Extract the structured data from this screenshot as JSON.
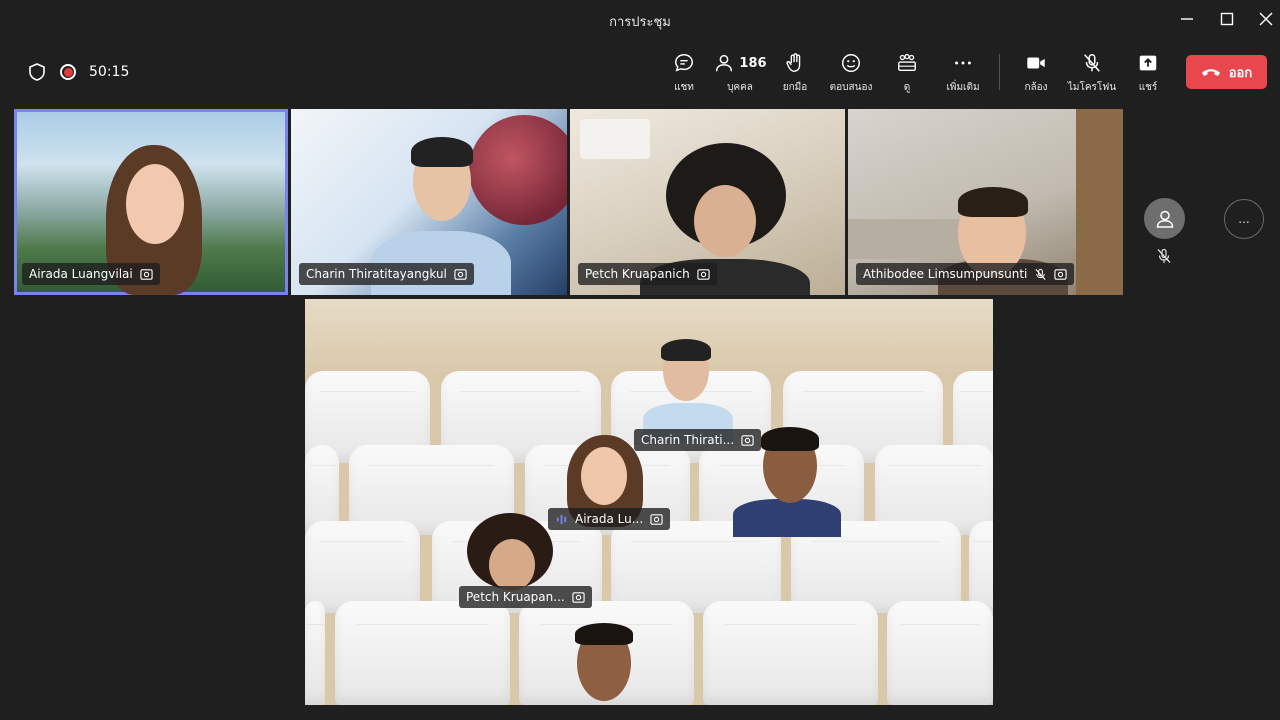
{
  "window": {
    "title": "การประชุม"
  },
  "toolbar": {
    "timer": "50:15",
    "buttons": [
      {
        "key": "chat",
        "label": "แชท",
        "icon": "chat-icon"
      },
      {
        "key": "people",
        "label": "บุคคล",
        "icon": "people-icon",
        "count": "186"
      },
      {
        "key": "raise",
        "label": "ยกมือ",
        "icon": "raise-hand-icon"
      },
      {
        "key": "react",
        "label": "ตอบสนอง",
        "icon": "smiley-icon"
      },
      {
        "key": "view",
        "label": "ดู",
        "icon": "view-icon"
      },
      {
        "key": "more",
        "label": "เพิ่มเติม",
        "icon": "more-icon"
      },
      {
        "key": "camera",
        "label": "กล้อง",
        "icon": "camera-icon"
      },
      {
        "key": "mic",
        "label": "ไมโครโฟน",
        "icon": "mic-off-icon"
      },
      {
        "key": "share",
        "label": "แชร์",
        "icon": "share-icon"
      }
    ],
    "leave_label": "ออก"
  },
  "tiles": [
    {
      "name": "Airada Luangvilai",
      "active": true
    },
    {
      "name": "Charin Thiratitayangkul"
    },
    {
      "name": "Petch Kruapanich"
    },
    {
      "name": "Athibodee Limsumpunsunti",
      "muted": true
    }
  ],
  "together": {
    "labels": {
      "charin": "Charin Thirati...",
      "airada": "Airada Lu...",
      "petch": "Petch Kruapan..."
    }
  },
  "side": {
    "more_label": "..."
  },
  "colors": {
    "accent": "#7b83eb",
    "leave": "#e7474d",
    "background": "#1f1f1f"
  }
}
